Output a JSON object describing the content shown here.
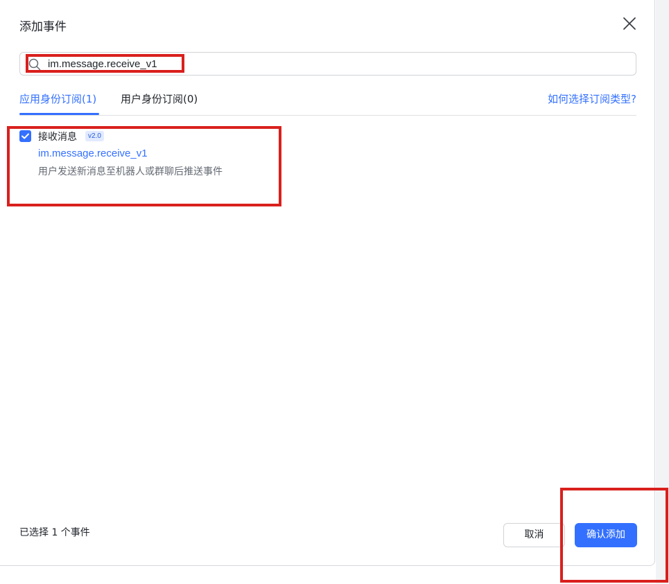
{
  "dialog": {
    "title": "添加事件",
    "close_icon": "close-icon"
  },
  "search": {
    "value": "im.message.receive_v1",
    "icon": "search-icon"
  },
  "tabs": [
    {
      "label": "应用身份订阅(1)",
      "active": true
    },
    {
      "label": "用户身份订阅(0)",
      "active": false
    }
  ],
  "help_link": "如何选择订阅类型?",
  "events": [
    {
      "checked": true,
      "name": "接收消息",
      "version": "v2.0",
      "key": "im.message.receive_v1",
      "description": "用户发送新消息至机器人或群聊后推送事件"
    }
  ],
  "footer": {
    "selected_text": "已选择 1 个事件",
    "cancel_label": "取消",
    "confirm_label": "确认添加"
  },
  "colors": {
    "accent": "#3370ff",
    "highlight": "#d9201d"
  }
}
